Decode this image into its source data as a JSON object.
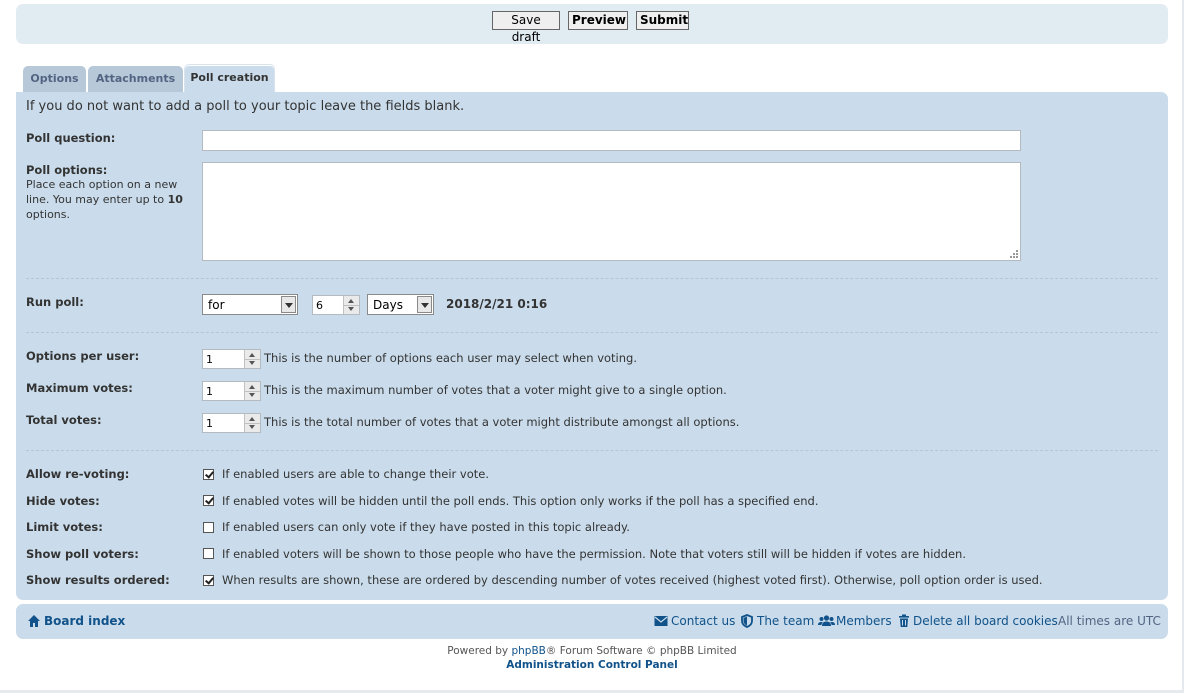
{
  "toolbar": {
    "save_draft_label": "Save draft",
    "preview_label": "Preview",
    "submit_label": "Submit"
  },
  "tabs": [
    {
      "label": "Options",
      "active": false
    },
    {
      "label": "Attachments",
      "active": false
    },
    {
      "label": "Poll creation",
      "active": true
    }
  ],
  "poll": {
    "intro": "If you do not want to add a poll to your topic leave the fields blank.",
    "question_label": "Poll question:",
    "question_value": "",
    "options_label": "Poll options:",
    "options_help_before": "Place each option on a new line. You may enter up to",
    "options_help_max": "10",
    "options_help_after": "options.",
    "options_value": "",
    "run_label": "Run poll:",
    "run_mode": "for",
    "run_length": "6",
    "run_unit": "Days",
    "run_end": "2018/2/21 0:16",
    "options_per_user_label": "Options per user:",
    "options_per_user_value": "1",
    "options_per_user_explain": "This is the number of options each user may select when voting.",
    "max_votes_label": "Maximum votes:",
    "max_votes_value": "1",
    "max_votes_explain": "This is the maximum number of votes that a voter might give to a single option.",
    "total_votes_label": "Total votes:",
    "total_votes_value": "1",
    "total_votes_explain": "This is the total number of votes that a voter might distribute amongst all options.",
    "checks": [
      {
        "label": "Allow re-voting:",
        "checked": true,
        "text": "If enabled users are able to change their vote."
      },
      {
        "label": "Hide votes:",
        "checked": true,
        "text": "If enabled votes will be hidden until the poll ends. This option only works if the poll has a specified end."
      },
      {
        "label": "Limit votes:",
        "checked": false,
        "text": "If enabled users can only vote if they have posted in this topic already."
      },
      {
        "label": "Show poll voters:",
        "checked": false,
        "text": "If enabled voters will be shown to those people who have the permission. Note that voters still will be hidden if votes are hidden."
      },
      {
        "label": "Show results ordered:",
        "checked": true,
        "text": "When results are shown, these are ordered by descending number of votes received (highest voted first). Otherwise, poll option order is used."
      }
    ]
  },
  "footer": {
    "board_index": "Board index",
    "contact_us": "Contact us",
    "the_team": "The team",
    "members": "Members",
    "delete_cookies": "Delete all board cookies",
    "times": "All times are UTC",
    "powered_before": "Powered by",
    "powered_link": "phpBB",
    "powered_after": "® Forum Software © phpBB Limited",
    "acp": "Administration Control Panel"
  },
  "colors": {
    "panel": "#cadceb",
    "link": "#105289"
  }
}
